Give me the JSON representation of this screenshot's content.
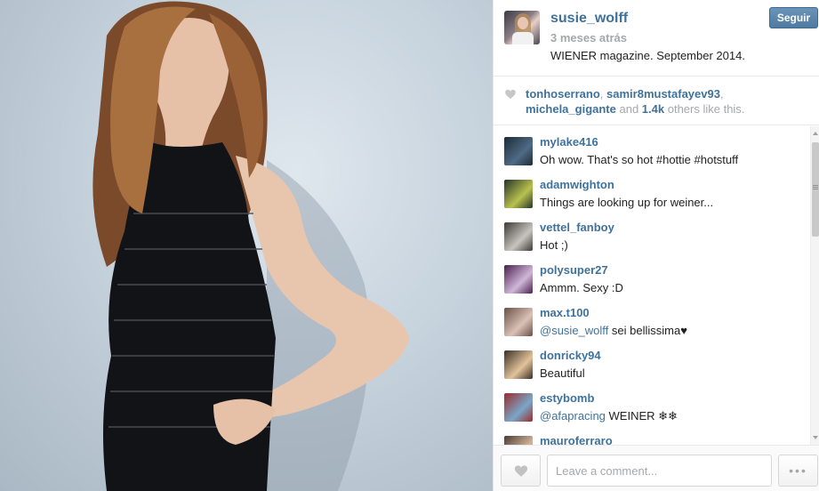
{
  "post": {
    "username": "susie_wolff",
    "time_ago": "3 meses atrás",
    "caption": "WIENER magazine. September 2014.",
    "follow_label": "Seguir"
  },
  "likes": {
    "users": [
      "tonhoserrano",
      "samir8mustafayev93",
      "michela_gigante"
    ],
    "sep1": ", ",
    "sep2": ",",
    "and_text": " and ",
    "count": "1.4k",
    "suffix": " others like this."
  },
  "comments": [
    {
      "user": "mylake416",
      "text": "Oh wow. That's so hot #hottie #hotstuff",
      "colors": [
        "#1d2a36",
        "#4f6b86"
      ]
    },
    {
      "user": "adamwighton",
      "text": "Things are looking up for weiner...",
      "colors": [
        "#253229",
        "#b9c24e"
      ]
    },
    {
      "user": "vettel_fanboy",
      "text": "Hot ;)",
      "colors": [
        "#3c3a36",
        "#c8c5c0"
      ]
    },
    {
      "user": "polysuper27",
      "text": "Ammm. Sexy :D",
      "colors": [
        "#4a1f4d",
        "#cfb7d8"
      ]
    },
    {
      "user": "max.t100",
      "mention": "@susie_wolff",
      "text": " sei bellissima♥",
      "colors": [
        "#6b4f46",
        "#d9c2b6"
      ]
    },
    {
      "user": "donricky94",
      "text": "Beautiful",
      "colors": [
        "#3a2f25",
        "#e2c39a"
      ]
    },
    {
      "user": "estybomb",
      "mention": "@afapracing",
      "text": " WEINER ❄❄",
      "colors": [
        "#9b2b2b",
        "#7aa7c9"
      ]
    },
    {
      "user": "mauroferraro",
      "text": "",
      "colors": [
        "#4a3b33",
        "#d2b49c"
      ]
    }
  ],
  "footer": {
    "comment_placeholder": "Leave a comment...",
    "more_label": "•••"
  },
  "icons": {
    "likes_heart": "heart-icon",
    "like_button": "heart-icon",
    "more": "ellipsis-icon"
  },
  "colors": {
    "link": "#3f729b",
    "muted": "#a5a7aa",
    "follow_button": "#4f7ba1"
  }
}
